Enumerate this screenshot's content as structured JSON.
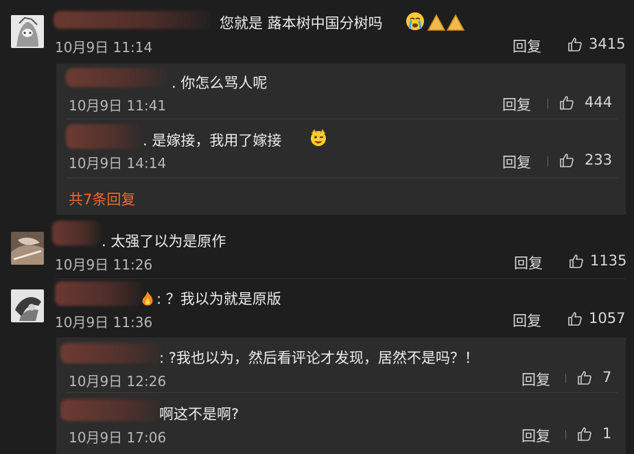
{
  "comments": [
    {
      "text": "您就是 蕗本树中国分树吗",
      "time": "10月9日 11:14",
      "reply_label": "回复",
      "likes": "3415",
      "replies": [
        {
          "text": ". 你怎么骂人呢",
          "time": "10月9日 11:41",
          "reply_label": "回复",
          "likes": "444"
        },
        {
          "text": ". 是嫁接，我用了嫁接",
          "time": "10月9日 14:14",
          "reply_label": "回复",
          "likes": "233"
        }
      ],
      "more_replies": "共7条回复"
    },
    {
      "text": ". 太强了以为是原作",
      "time": "10月9日 11:26",
      "reply_label": "回复",
      "likes": "1135"
    },
    {
      "text": ": ？我以为就是原版",
      "time": "10月9日 11:36",
      "reply_label": "回复",
      "likes": "1057",
      "replies": [
        {
          "text": ": ?我也以为，然后看评论才发现，居然不是吗？！",
          "time": "10月9日 12:26",
          "reply_label": "回复",
          "likes": "7"
        },
        {
          "text": "啊这不是啊?",
          "time": "10月9日 17:06",
          "reply_label": "回复",
          "likes": "1"
        }
      ]
    }
  ],
  "colors": {
    "background": "#1e1e1e",
    "panel": "#2c2c2c",
    "accent": "#f06a2a"
  }
}
